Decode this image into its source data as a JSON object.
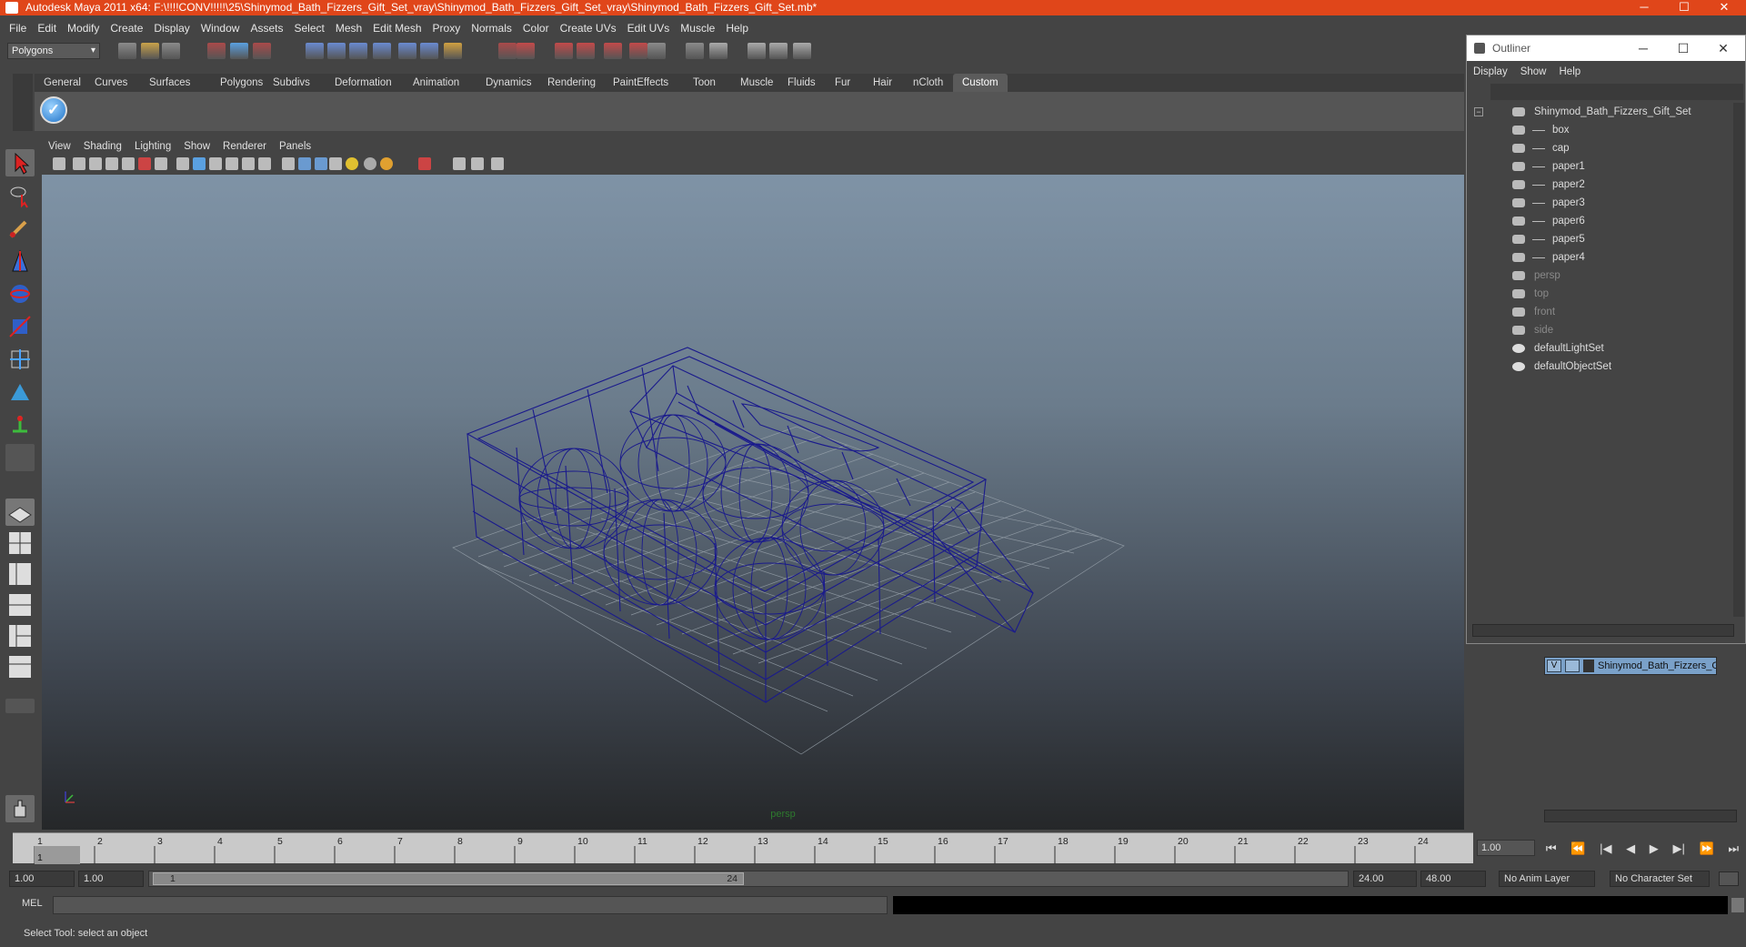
{
  "window": {
    "title": "Autodesk Maya 2011 x64: F:\\!!!!CONV!!!!!\\25\\Shinymod_Bath_Fizzers_Gift_Set_vray\\Shinymod_Bath_Fizzers_Gift_Set_vray\\Shinymod_Bath_Fizzers_Gift_Set.mb*",
    "minimize": "─",
    "maximize": "☐",
    "close": "✕"
  },
  "menubar": [
    "File",
    "Edit",
    "Modify",
    "Create",
    "Display",
    "Window",
    "Assets",
    "Select",
    "Mesh",
    "Edit Mesh",
    "Proxy",
    "Normals",
    "Color",
    "Create UVs",
    "Edit UVs",
    "Muscle",
    "Help"
  ],
  "statusline": {
    "mode": "Polygons"
  },
  "shelf": {
    "tabs": [
      "General",
      "Curves",
      "Surfaces",
      "Polygons",
      "Subdivs",
      "Deformation",
      "Animation",
      "Dynamics",
      "Rendering",
      "PaintEffects",
      "Toon",
      "Muscle",
      "Fluids",
      "Fur",
      "Hair",
      "nCloth",
      "Custom"
    ],
    "active_tab": "Custom",
    "icon_glyph": "✓"
  },
  "panel": {
    "menu": [
      "View",
      "Shading",
      "Lighting",
      "Show",
      "Renderer",
      "Panels"
    ],
    "camera_label": "persp"
  },
  "timeline": {
    "ticks": [
      "1",
      "2",
      "3",
      "4",
      "5",
      "6",
      "7",
      "8",
      "9",
      "10",
      "11",
      "12",
      "13",
      "14",
      "15",
      "16",
      "17",
      "18",
      "19",
      "20",
      "21",
      "22",
      "23",
      "24"
    ],
    "current_frame_label": "1",
    "current_frame": "1.00",
    "playback_buttons": [
      "⏮",
      "⏪",
      "|◀",
      "◀",
      "▶",
      "▶|",
      "⏩",
      "⏭"
    ]
  },
  "range": {
    "start": "1.00",
    "playback_start": "1.00",
    "handle_start": "1",
    "handle_end": "24",
    "playback_end": "24.00",
    "end": "48.00",
    "anim_layer": "No Anim Layer",
    "character_set": "No Character Set"
  },
  "command": {
    "language": "MEL"
  },
  "helpline": "Select Tool: select an object",
  "outliner": {
    "title": "Outliner",
    "menu": [
      "Display",
      "Show",
      "Help"
    ],
    "items": [
      {
        "label": "Shinymod_Bath_Fizzers_Gift_Set",
        "dim": false,
        "level": 0
      },
      {
        "label": "box",
        "dim": false,
        "level": 1
      },
      {
        "label": "cap",
        "dim": false,
        "level": 1
      },
      {
        "label": "paper1",
        "dim": false,
        "level": 1
      },
      {
        "label": "paper2",
        "dim": false,
        "level": 1
      },
      {
        "label": "paper3",
        "dim": false,
        "level": 1
      },
      {
        "label": "paper6",
        "dim": false,
        "level": 1
      },
      {
        "label": "paper5",
        "dim": false,
        "level": 1
      },
      {
        "label": "paper4",
        "dim": false,
        "level": 1
      },
      {
        "label": "persp",
        "dim": true,
        "level": 0
      },
      {
        "label": "top",
        "dim": true,
        "level": 0
      },
      {
        "label": "front",
        "dim": true,
        "level": 0
      },
      {
        "label": "side",
        "dim": true,
        "level": 0
      },
      {
        "label": "defaultLightSet",
        "dim": false,
        "level": 0
      },
      {
        "label": "defaultObjectSet",
        "dim": false,
        "level": 0
      }
    ]
  },
  "layers": {
    "visible_flag": "V",
    "name": "Shinymod_Bath_Fizzers_Gift_Set"
  }
}
